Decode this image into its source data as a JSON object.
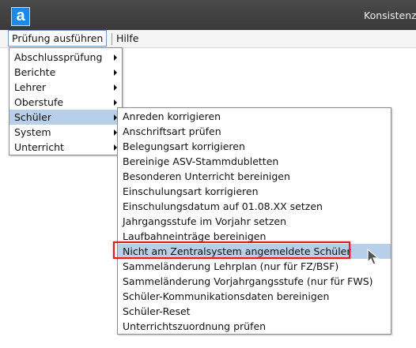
{
  "window": {
    "logo_letter": "a",
    "title": "Konsistenz"
  },
  "menubar": {
    "items": [
      {
        "label": "Prüfung ausführen",
        "active": true
      },
      {
        "label": "Hilfe",
        "active": false
      }
    ]
  },
  "main_menu": {
    "items": [
      {
        "label": "Abschlussprüfung",
        "submenu": true
      },
      {
        "label": "Berichte",
        "submenu": true
      },
      {
        "label": "Lehrer",
        "submenu": true
      },
      {
        "label": "Oberstufe",
        "submenu": true
      },
      {
        "label": "Schüler",
        "submenu": true,
        "highlighted": true
      },
      {
        "label": "System",
        "submenu": true
      },
      {
        "label": "Unterricht",
        "submenu": true
      }
    ]
  },
  "schueler_submenu": {
    "items": [
      {
        "label": "Anreden korrigieren"
      },
      {
        "label": "Anschriftsart prüfen"
      },
      {
        "label": "Belegungsart korrigieren"
      },
      {
        "label": "Bereinige ASV-Stammdubletten"
      },
      {
        "label": "Besonderen Unterricht bereinigen"
      },
      {
        "label": "Einschulungsart korrigieren"
      },
      {
        "label": "Einschulungsdatum auf 01.08.XX setzen"
      },
      {
        "label": "Jahrgangsstufe im Vorjahr setzen"
      },
      {
        "label": "Laufbahneinträge bereinigen"
      },
      {
        "label": "Nicht am Zentralsystem angemeldete Schüler",
        "highlighted": true
      },
      {
        "label": "Sammeländerung Lehrplan (nur für FZ/BSF)"
      },
      {
        "label": "Sammeländerung Vorjahrgangsstufe (nur für FWS)"
      },
      {
        "label": "Schüler-Kommunikationsdaten bereinigen"
      },
      {
        "label": "Schüler-Reset"
      },
      {
        "label": "Unterrichtszuordnung prüfen"
      }
    ]
  },
  "colors": {
    "titlebar": "#3f3f3f",
    "highlight": "#b8cfea",
    "annotation_frame": "#e02020",
    "logo": "#1e88e5"
  }
}
